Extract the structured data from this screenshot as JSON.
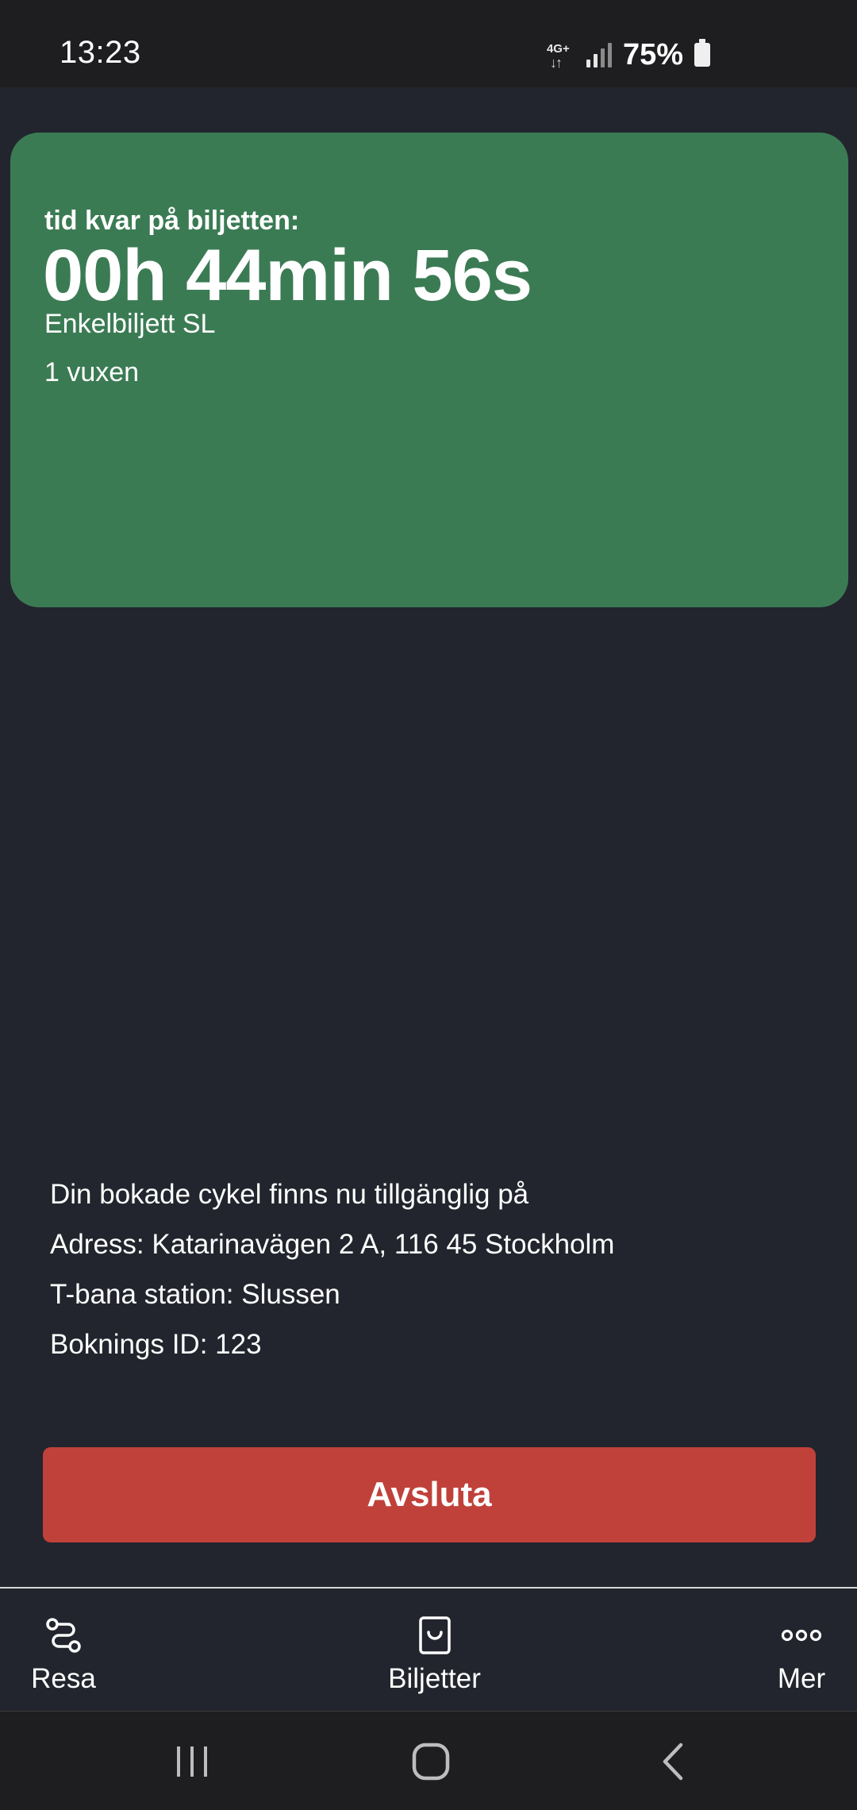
{
  "status_bar": {
    "time": "13:23",
    "network_label": "4G+",
    "battery_percent": "75%",
    "icons": [
      "network-4g-icon",
      "signal-icon",
      "battery-icon"
    ]
  },
  "ticket": {
    "caption": "tid kvar på biljetten:",
    "time_remaining": "00h 44min 56s",
    "ticket_type": "Enkelbiljett SL",
    "passengers": "1 vuxen",
    "card_color": "#3b7b54"
  },
  "info": {
    "lines": [
      "Din bokade cykel finns nu tillgänglig på",
      "Adress: Katarinavägen 2 A, 116 45 Stockholm",
      "T-bana station: Slussen",
      "Boknings ID: 123"
    ]
  },
  "action": {
    "finish_label": "Avsluta",
    "button_color": "#c0413a"
  },
  "tabs": [
    {
      "label": "Resa",
      "icon": "route-icon"
    },
    {
      "label": "Biljetter",
      "icon": "ticket-icon"
    },
    {
      "label": "Mer",
      "icon": "more-dots-icon"
    }
  ],
  "system_nav": {
    "icons": [
      "recent-apps-icon",
      "home-icon",
      "back-icon"
    ]
  },
  "colors": {
    "background": "#22252d",
    "status_bar": "#1e1e20"
  }
}
